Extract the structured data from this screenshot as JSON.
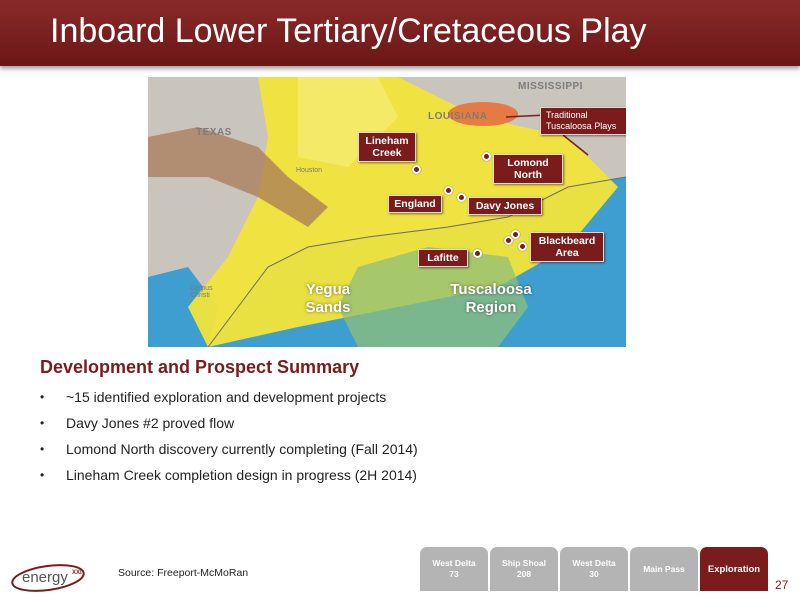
{
  "slide": {
    "title": "Inboard Lower Tertiary/Cretaceous Play",
    "page_number": "27",
    "source": "Source: Freeport-McMoRan",
    "logo_text": "energy",
    "logo_suffix": "XXI"
  },
  "map": {
    "state_labels": [
      "TEXAS",
      "LOUISIANA",
      "MISSISSIPPI"
    ],
    "city_labels": [
      "Houston",
      "Corpus Christi"
    ],
    "prospects": [
      "Lineham Creek",
      "Lomond North",
      "England",
      "Davy Jones",
      "Lafitte",
      "Blackbeard Area"
    ],
    "callout": "Traditional Tuscaloosa Plays",
    "regions": [
      "Yegua Sands",
      "Tuscaloosa Region"
    ],
    "colors": {
      "yellow": "#f2e43a",
      "water": "#3f9ed0",
      "land": "#c9c5bd",
      "brown_band": "#a87a58",
      "orange_band": "#e8713a",
      "green_overlay": "#8fbf78",
      "label_fill": "#7a1c1c"
    }
  },
  "summary": {
    "heading": "Development and Prospect Summary",
    "bullet_mark": "•",
    "items": [
      "~15 identified exploration and development projects",
      "Davy Jones #2 proved flow",
      "Lomond North discovery currently completing (Fall 2014)",
      "Lineham Creek completion design in progress (2H 2014)"
    ]
  },
  "nav": {
    "tabs": [
      {
        "label": "West Delta\n73",
        "active": false
      },
      {
        "label": "Ship Shoal\n208",
        "active": false
      },
      {
        "label": "West Delta\n30",
        "active": false
      },
      {
        "label": "Main Pass",
        "active": false
      },
      {
        "label": "Exploration",
        "active": true
      }
    ]
  }
}
